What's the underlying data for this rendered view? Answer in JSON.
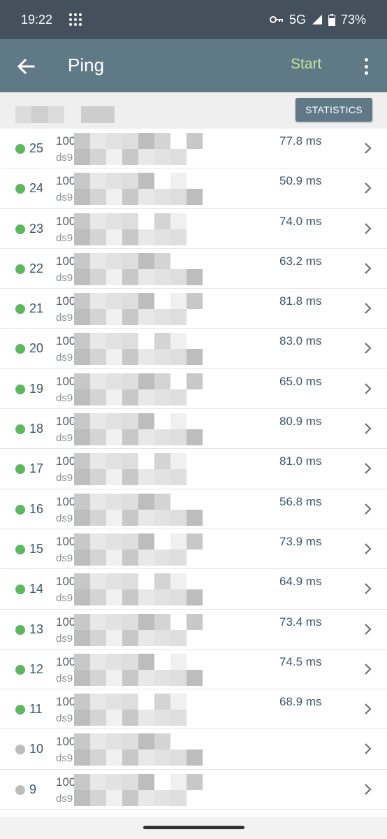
{
  "status_bar": {
    "time": "19:22",
    "network": "5G",
    "battery": "73%",
    "icons": [
      "apps-grid-icon",
      "vpn-key-icon",
      "signal-icon",
      "battery-icon"
    ]
  },
  "app_bar": {
    "title": "Ping",
    "start_label": "Start",
    "icons": [
      "back-arrow-icon",
      "more-vert-icon"
    ]
  },
  "subheader": {
    "statistics_label": "STATISTICS"
  },
  "colors": {
    "status_bar_bg": "#44505c",
    "app_bar_bg": "#5f7987",
    "start_text": "#c5e59a",
    "success_dot": "#5cb85c",
    "pending_dot": "#bdbdbd"
  },
  "rows": [
    {
      "seq": "25",
      "host": "100",
      "sub": "ds9",
      "time": "77.8 ms",
      "status": "success"
    },
    {
      "seq": "24",
      "host": "100",
      "sub": "ds9",
      "time": "50.9 ms",
      "status": "success"
    },
    {
      "seq": "23",
      "host": "100",
      "sub": "ds9",
      "time": "74.0 ms",
      "status": "success"
    },
    {
      "seq": "22",
      "host": "100",
      "sub": "ds9",
      "time": "63.2 ms",
      "status": "success"
    },
    {
      "seq": "21",
      "host": "100",
      "sub": "ds9",
      "time": "81.8 ms",
      "status": "success"
    },
    {
      "seq": "20",
      "host": "100",
      "sub": "ds9",
      "time": "83.0 ms",
      "status": "success"
    },
    {
      "seq": "19",
      "host": "100",
      "sub": "ds9",
      "time": "65.0 ms",
      "status": "success"
    },
    {
      "seq": "18",
      "host": "100",
      "sub": "ds9",
      "time": "80.9 ms",
      "status": "success"
    },
    {
      "seq": "17",
      "host": "100",
      "sub": "ds9",
      "time": "81.0 ms",
      "status": "success"
    },
    {
      "seq": "16",
      "host": "100",
      "sub": "ds9",
      "time": "56.8 ms",
      "status": "success"
    },
    {
      "seq": "15",
      "host": "100",
      "sub": "ds9",
      "time": "73.9 ms",
      "status": "success"
    },
    {
      "seq": "14",
      "host": "100",
      "sub": "ds9",
      "time": "64.9 ms",
      "status": "success"
    },
    {
      "seq": "13",
      "host": "100",
      "sub": "ds9",
      "time": "73.4 ms",
      "status": "success"
    },
    {
      "seq": "12",
      "host": "100",
      "sub": "ds9",
      "time": "74.5 ms",
      "status": "success"
    },
    {
      "seq": "11",
      "host": "100",
      "sub": "ds9",
      "time": "68.9 ms",
      "status": "success"
    },
    {
      "seq": "10",
      "host": "100",
      "sub": "ds9",
      "time": "",
      "status": "pending"
    },
    {
      "seq": "9",
      "host": "100",
      "sub": "ds9",
      "time": "",
      "status": "pending"
    }
  ]
}
